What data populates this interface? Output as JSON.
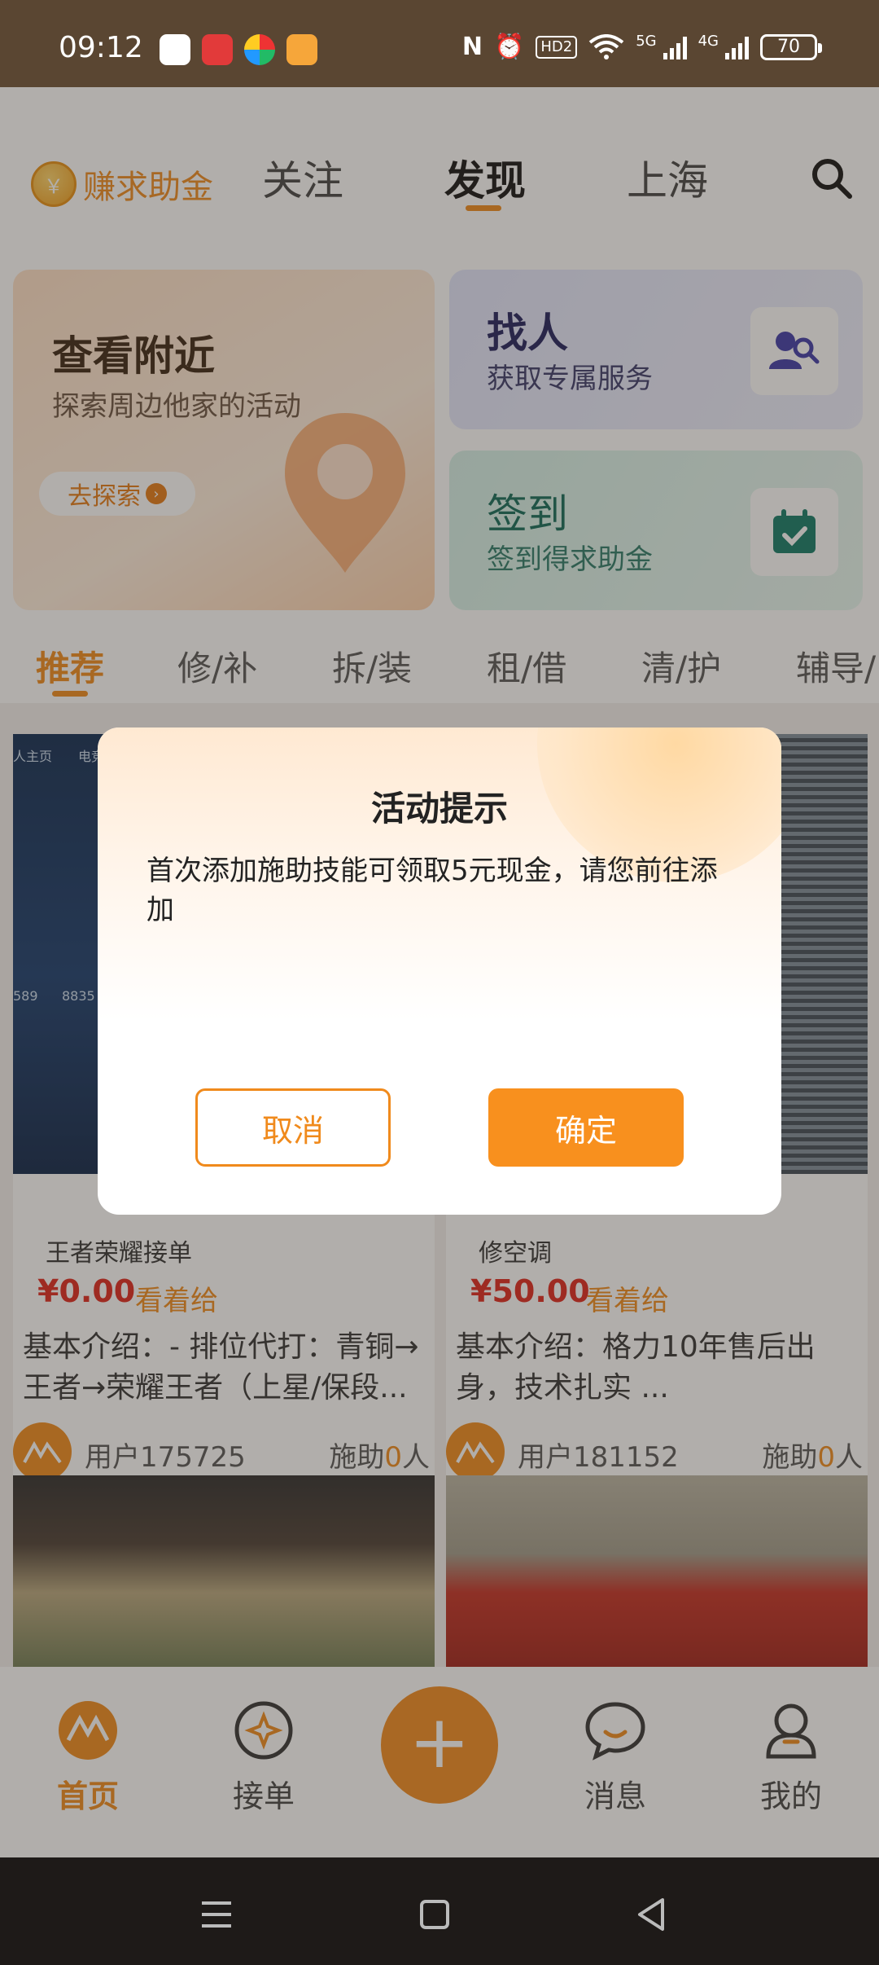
{
  "status_bar": {
    "time": "09:12",
    "hd_label": "HD2",
    "net1": "5G",
    "net2": "4G",
    "battery": "70",
    "icons": [
      "nfc-icon",
      "alarm-icon",
      "wifi-icon"
    ]
  },
  "header": {
    "logo_text": "赚求助金",
    "tabs": [
      {
        "label": "关注"
      },
      {
        "label": "发现"
      },
      {
        "label": "上海"
      }
    ],
    "active_tab": "发现"
  },
  "promo": {
    "nearby": {
      "title": "查看附近",
      "subtitle": "探索周边他家的活动",
      "button": "去探索"
    },
    "find": {
      "title": "找人",
      "subtitle": "获取专属服务"
    },
    "sign": {
      "title": "签到",
      "subtitle": "签到得求助金"
    }
  },
  "categories": [
    "推荐",
    "修/补",
    "拆/装",
    "租/借",
    "清/护",
    "辅导/"
  ],
  "items": [
    {
      "title": "王者荣耀接单",
      "price": "¥0.00",
      "price_note": "看着给",
      "desc": "基本介绍：- 排位代打：青铜→王者→荣耀王者（上星/保段...",
      "user": "用户175725",
      "helpers_prefix": "施助",
      "helpers_count": "0",
      "helpers_suffix": "人"
    },
    {
      "title": "修空调",
      "price": "¥50.00",
      "price_note": "看着给",
      "desc": "基本介绍：格力10年售后出身，技术扎实 ...",
      "user": "用户181152",
      "helpers_prefix": "施助",
      "helpers_count": "0",
      "helpers_suffix": "人"
    }
  ],
  "game_image_text": {
    "tab1": "人主页",
    "tab2": "电竞",
    "n1": "589",
    "n2": "8835"
  },
  "bottom_nav": {
    "home": "首页",
    "orders": "接单",
    "messages": "消息",
    "me": "我的",
    "plus": "+"
  },
  "dialog": {
    "title": "活动提示",
    "message": "首次添加施助技能可领取5元现金，请您前往添加",
    "cancel": "取消",
    "confirm": "确定"
  },
  "colors": {
    "accent": "#f08a1c",
    "price": "#e0251c",
    "status_bar_bg": "#5a4632"
  }
}
